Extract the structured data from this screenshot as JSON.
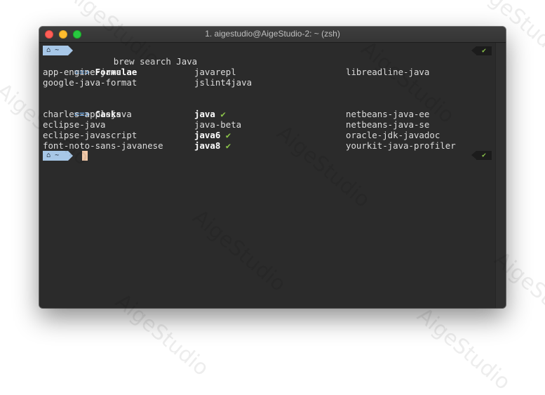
{
  "watermark": "AigeStudio",
  "window": {
    "title": "1. aigestudio@AigeStudio-2: ~ (zsh)"
  },
  "prompt": {
    "home_icon": "home-icon",
    "path": "~",
    "status_icon": "checkmark-icon",
    "status_glyph": "✔"
  },
  "command": "brew search Java",
  "formulae": {
    "header_arrow": "==>",
    "header": "Formulae",
    "rows": [
      [
        "app-engine-java",
        "javarepl",
        "libreadline-java"
      ],
      [
        "google-java-format",
        "jslint4java",
        ""
      ]
    ]
  },
  "casks": {
    "header_arrow": "==>",
    "header": "Casks",
    "rows": [
      {
        "c1": "charles-applejava",
        "c2": "java",
        "c2_installed": true,
        "c3": "netbeans-java-ee"
      },
      {
        "c1": "eclipse-java",
        "c2": "java-beta",
        "c2_installed": false,
        "c3": "netbeans-java-se"
      },
      {
        "c1": "eclipse-javascript",
        "c2": "java6",
        "c2_installed": true,
        "c3": "oracle-jdk-javadoc"
      },
      {
        "c1": "font-noto-sans-javanese",
        "c2": "java8",
        "c2_installed": true,
        "c3": "yourkit-java-profiler"
      }
    ],
    "installed_glyph": "✔"
  },
  "colors": {
    "accent": "#a7c7e7",
    "check": "#8bc34a",
    "background": "#2b2b2b",
    "cursor": "#f2c9a8"
  }
}
